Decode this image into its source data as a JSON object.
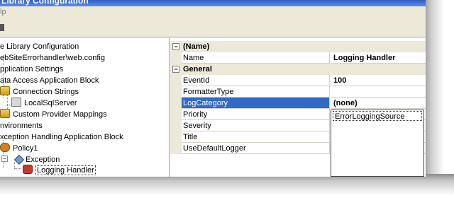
{
  "window": {
    "title": "Library Configuration"
  },
  "menu": {
    "help": "lp"
  },
  "tree": {
    "items": [
      {
        "label": "e Library Configuration"
      },
      {
        "label": "ebSiteErrorhandler\\web.config"
      },
      {
        "label": "pplication Settings"
      },
      {
        "label": "ata Access Application Block"
      },
      {
        "label": "Connection Strings"
      },
      {
        "label": "LocalSqlServer"
      },
      {
        "label": "Custom Provider Mappings"
      },
      {
        "label": "nvironments"
      },
      {
        "label": "xception Handling Application Block"
      },
      {
        "label": "Policy1"
      },
      {
        "label": "Exception"
      },
      {
        "label": "Logging Handler"
      }
    ]
  },
  "properties": {
    "category_name": "(Name)",
    "category_general": "General",
    "rows": [
      {
        "name": "Name",
        "value": "Logging Handler"
      },
      {
        "name": "EventId",
        "value": "100"
      },
      {
        "name": "FormatterType",
        "value": ""
      },
      {
        "name": "LogCategory",
        "value": "(none)"
      },
      {
        "name": "Priority",
        "value": ""
      },
      {
        "name": "Severity",
        "value": ""
      },
      {
        "name": "Title",
        "value": ""
      },
      {
        "name": "UseDefaultLogger",
        "value": ""
      }
    ]
  },
  "dropdown": {
    "options": [
      "ErrorLoggingSource"
    ]
  },
  "colors": {
    "selection": "#316ac5",
    "titlebar": "#2f5fc8",
    "chrome": "#ece9d8"
  }
}
